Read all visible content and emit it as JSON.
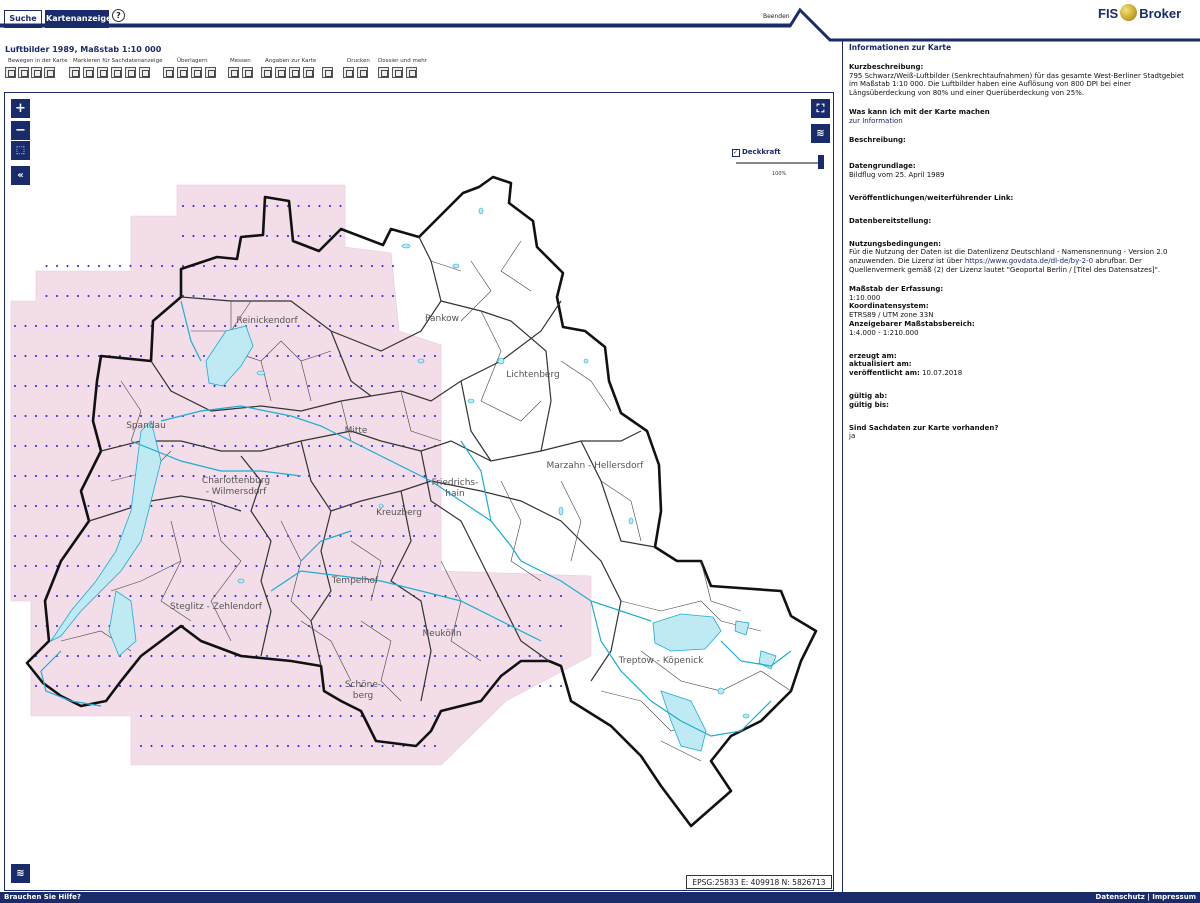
{
  "tabs": {
    "search": "Suche",
    "map": "Kartenanzeige"
  },
  "help_icon": "question-icon",
  "exit_label": "Beenden",
  "logo": {
    "left": "FIS",
    "right": "Broker"
  },
  "map": {
    "title": "Luftbilder 1989, Maßstab 1:10 000",
    "toolgroups": [
      "Bewegen in der Karte",
      "Markieren für Sachdatenanzeige",
      "Überlagern",
      "Messen",
      "Angaben zur Karte",
      "Drucken",
      "Dossier und mehr"
    ],
    "opacity_label": "Deckkraft",
    "opacity_value": "100%",
    "opacity_level": 1.0,
    "coords": "EPSG:25833 E: 409918 N: 5826713",
    "districts": [
      "Reinickendorf",
      "Pankow",
      "Lichtenberg",
      "Spandau",
      "Mitte",
      "Marzahn - Hellersdorf",
      "Charlottenburg - Wilmersdorf",
      "Friedrichs- hain",
      "Kreuzberg",
      "Tempelhof",
      "Steglitz - Zehlendorf",
      "Neukölln",
      "Treptow - Köpenick",
      "Schöne- berg"
    ],
    "colors": {
      "accent": "#1a2b6b",
      "coverage": "#f2dde8",
      "water": "#bfe9f3",
      "water_line": "#1aaed0",
      "points": "#2222dd"
    }
  },
  "info": {
    "heading": "Informationen zur Karte",
    "kurz_label": "Kurzbeschreibung:",
    "kurz_text": "795 Schwarz/Weiß-Luftbilder (Senkrechtaufnahmen) für das gesamte West-Berliner Stadtgebiet im Maßstab 1:10 000. Die Luftbilder haben eine Auflösung von 800 DPI bei einer Längsüberdeckung von 80% und einer Querüberdeckung von 25%.",
    "was_label": "Was kann ich mit der Karte machen",
    "was_link": "zur Information",
    "beschreibung_label": "Beschreibung:",
    "grundlage_label": "Datengrundlage:",
    "grundlage_text": "Bildflug vom 25. April 1989",
    "veroeff_label": "Veröffentlichungen/weiterführender Link:",
    "bereit_label": "Datenbereitstellung:",
    "nutzung_label": "Nutzungsbedingungen:",
    "nutzung_text1": "Für die Nutzung der Daten ist die Datenlizenz Deutschland - Namensnennung - Version 2.0 anzuwenden. Die Lizenz ist über",
    "nutzung_link": "https://www.govdata.de/dl-de/by-2-0",
    "nutzung_text2": "abrufbar. Der Quellenvermerk gemäß (2) der Lizenz lautet \"Geoportal Berlin / [Titel des Datensatzes]\".",
    "massstab_label": "Maßstab der Erfassung:",
    "massstab_value": "1:10.000",
    "koord_label": "Koordinatensystem:",
    "koord_value": "ETRS89 / UTM zone 33N",
    "anzeige_label": "Anzeigebarer Maßstabsbereich:",
    "anzeige_value": "1:4.000 - 1:210.000",
    "erzeugt_label": "erzeugt am:",
    "aktualisiert_label": "aktualisiert am:",
    "veroeffentlicht_label": "veröffentlicht am:",
    "veroeffentlicht_value": "10.07.2018",
    "gueltig_ab_label": "gültig ab:",
    "gueltig_bis_label": "gültig bis:",
    "sach_label": "Sind Sachdaten zur Karte vorhanden?",
    "sach_value": "ja"
  },
  "footer": {
    "help": "Brauchen Sie Hilfe?",
    "links": "Datenschutz | Impressum"
  }
}
